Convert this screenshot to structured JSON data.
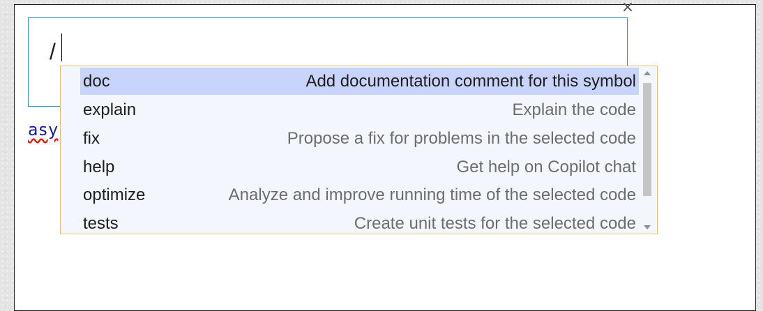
{
  "window": {
    "close_glyph": "×"
  },
  "chat_input": {
    "value": "/"
  },
  "code_fragment": "asy",
  "autocomplete": {
    "selected_index": 0,
    "items": [
      {
        "command": "doc",
        "description": "Add documentation comment for this symbol"
      },
      {
        "command": "explain",
        "description": "Explain the code"
      },
      {
        "command": "fix",
        "description": "Propose a fix for problems in the selected code"
      },
      {
        "command": "help",
        "description": "Get help on Copilot chat"
      },
      {
        "command": "optimize",
        "description": "Analyze and improve running time of the selected code"
      },
      {
        "command": "tests",
        "description": "Create unit tests for the selected code"
      }
    ]
  },
  "colors": {
    "selection": "#c9d4fd",
    "popup_background": "#f4f6fd",
    "popup_border": "#e3c06f",
    "input_border": "#2e8fd3",
    "description_text": "#6d6d6d"
  }
}
